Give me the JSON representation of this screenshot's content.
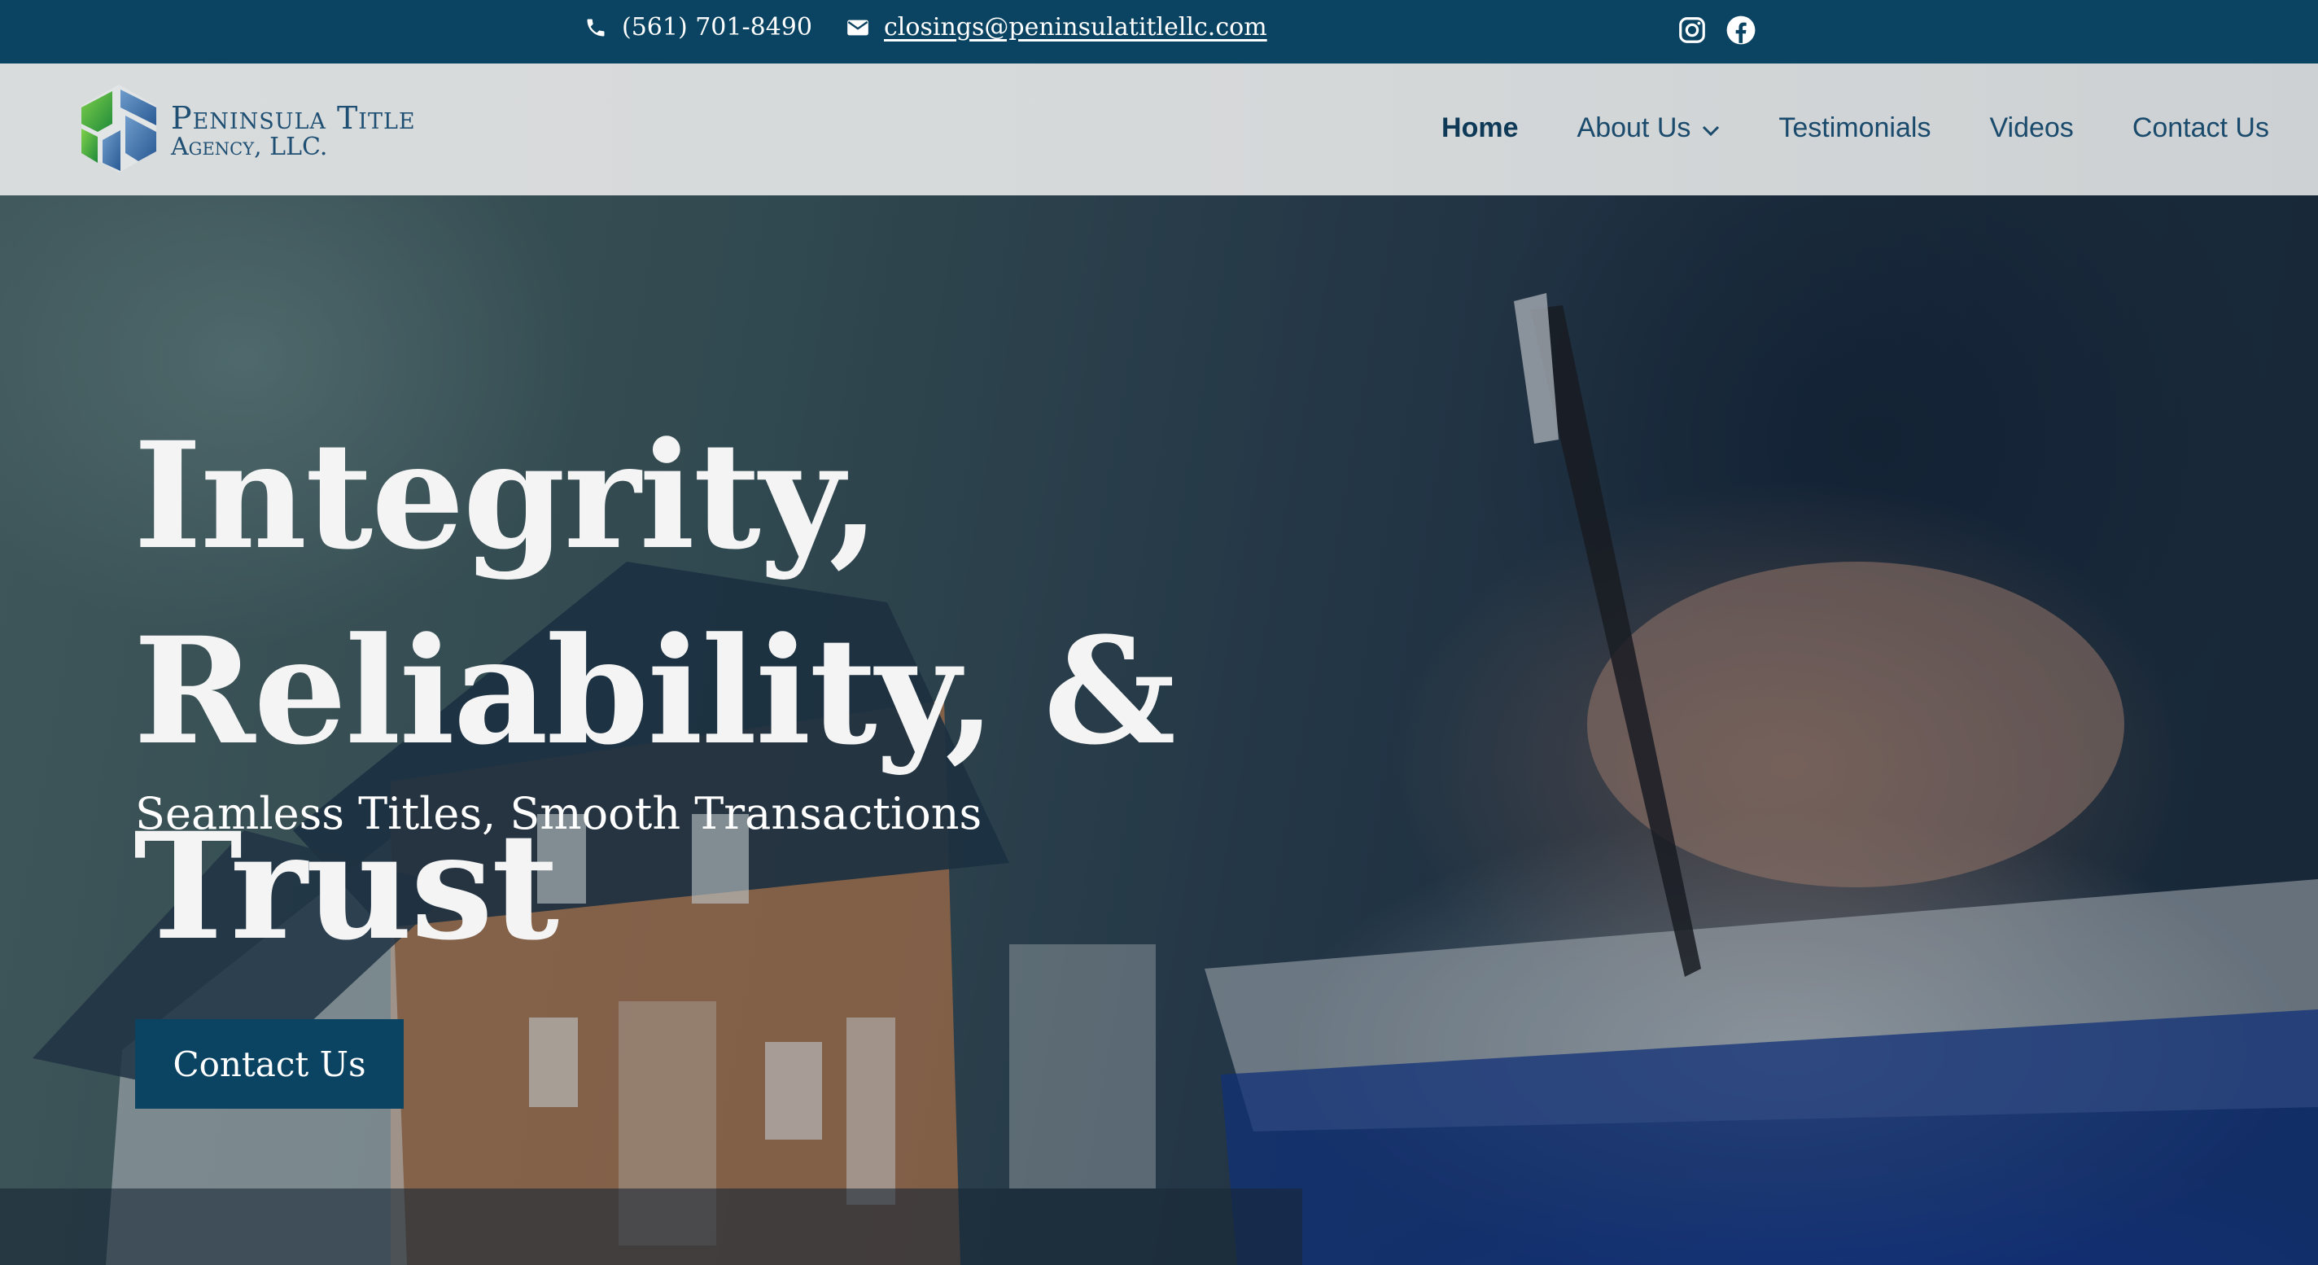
{
  "topbar": {
    "phone": "(561) 701-8490",
    "email": "closings@peninsulatitlellc.com",
    "icons": [
      "phone-icon",
      "mail-icon",
      "instagram-icon",
      "facebook-icon"
    ]
  },
  "brand": {
    "name_line1": "Peninsula Title",
    "name_line2": "Agency, LLC.",
    "colors": {
      "navy": "#0b4462",
      "green": "#3aa635",
      "blue": "#3c6fa6"
    }
  },
  "nav": {
    "items": [
      {
        "label": "Home",
        "active": true
      },
      {
        "label": "About Us",
        "has_dropdown": true
      },
      {
        "label": "Testimonials"
      },
      {
        "label": "Videos"
      },
      {
        "label": "Contact Us"
      }
    ]
  },
  "hero": {
    "headline_line1": "Integrity,",
    "headline_line2": "Reliability, & Trust",
    "subheadline": "Seamless Titles, Smooth Transactions",
    "cta_label": "Contact Us"
  }
}
